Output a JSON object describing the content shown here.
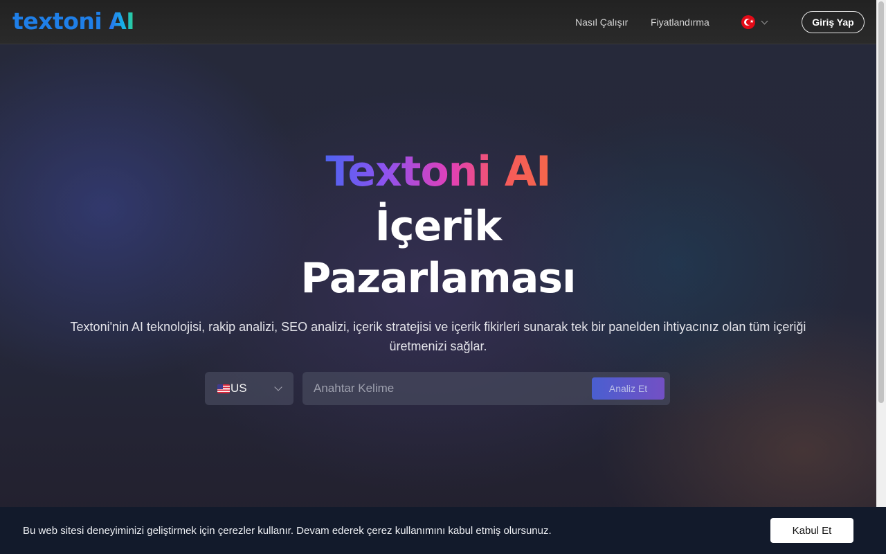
{
  "header": {
    "logo_text": "textoni",
    "logo_ai": "AI",
    "nav": [
      {
        "label": "Nasıl Çalışır"
      },
      {
        "label": "Fiyatlandırma"
      }
    ],
    "language": {
      "selected": "TR",
      "icon": "turkey-flag-icon"
    },
    "login_label": "Giriş Yap"
  },
  "hero": {
    "title_gradient": "Textoni AI",
    "title_line2": "İçerik",
    "title_line3": "Pazarlaması",
    "subtitle": "Textoni'nin AI teknolojisi, rakip analizi, SEO analizi, içerik stratejisi ve içerik fikirleri sunarak tek bir panelden ihtiyacınız olan tüm içeriği üretmenizi sağlar.",
    "country": {
      "selected": "US",
      "icon": "us-flag-icon"
    },
    "keyword_placeholder": "Anahtar Kelime",
    "keyword_value": "",
    "analyze_label": "Analiz Et"
  },
  "cookie_banner": {
    "text": "Bu web sitesi deneyiminizi geliştirmek için çerezler kullanır. Devam ederek çerez kullanımını kabul etmiş olursunuz.",
    "accept_label": "Kabul Et"
  },
  "colors": {
    "accent_blue": "#4a5fd0",
    "accent_purple": "#7350c4",
    "title_gradient_start": "#4f63f0",
    "title_gradient_end": "#f5674a",
    "cookie_bg": "#121a2b"
  }
}
